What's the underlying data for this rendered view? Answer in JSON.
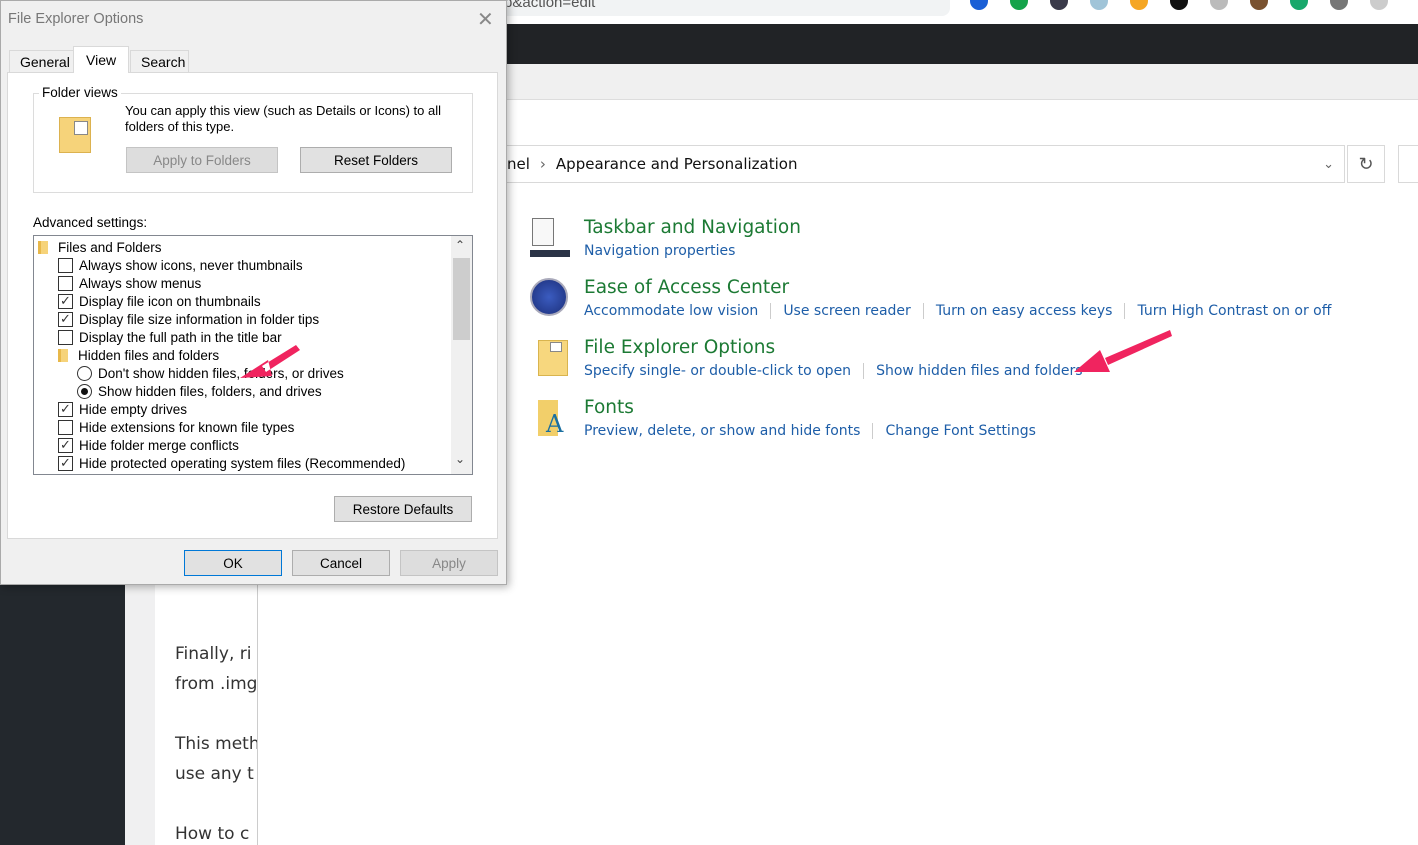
{
  "browser": {
    "address_fragment": "p&action=edit",
    "extension_colors": [
      "#1a5fd6",
      "#15a34a",
      "#3a3a4a",
      "#a0c4d8",
      "#f5a623",
      "#111111",
      "#bbbbbb",
      "#7a5230",
      "#18a86b",
      "#777777",
      "#cccccc"
    ]
  },
  "control_panel": {
    "breadcrumb": [
      "nel",
      "Appearance and Personalization"
    ],
    "categories": [
      {
        "title": "Taskbar and Navigation",
        "icon": "taskbar-icon",
        "links": [
          "Navigation properties"
        ]
      },
      {
        "title": "Ease of Access Center",
        "icon": "ease-of-access-icon",
        "links": [
          "Accommodate low vision",
          "Use screen reader",
          "Turn on easy access keys",
          "Turn High Contrast on or off"
        ]
      },
      {
        "title": "File Explorer Options",
        "icon": "folder-options-icon",
        "links": [
          "Specify single- or double-click to open",
          "Show hidden files and folders"
        ]
      },
      {
        "title": "Fonts",
        "icon": "fonts-icon",
        "links": [
          "Preview, delete, or show and hide fonts",
          "Change Font Settings"
        ]
      }
    ],
    "heading_color": "#1c7a34",
    "link_color": "#1e5ea8"
  },
  "article": {
    "lines": [
      "Finally, ri",
      "from .img",
      "This meth",
      "use any t",
      "How to c"
    ]
  },
  "dialog": {
    "title": "File Explorer Options",
    "tabs": [
      "General",
      "View",
      "Search"
    ],
    "active_tab": "View",
    "folder_views": {
      "label": "Folder views",
      "text": "You can apply this view (such as Details or Icons) to all folders of this type.",
      "apply_button": "Apply to Folders",
      "reset_button": "Reset Folders"
    },
    "advanced_label": "Advanced settings:",
    "settings": [
      {
        "type": "folder",
        "label": "Files and Folders"
      },
      {
        "type": "checkbox",
        "label": "Always show icons, never thumbnails",
        "checked": false
      },
      {
        "type": "checkbox",
        "label": "Always show menus",
        "checked": false
      },
      {
        "type": "checkbox",
        "label": "Display file icon on thumbnails",
        "checked": true
      },
      {
        "type": "checkbox",
        "label": "Display file size information in folder tips",
        "checked": true
      },
      {
        "type": "checkbox",
        "label": "Display the full path in the title bar",
        "checked": false
      },
      {
        "type": "folder",
        "label": "Hidden files and folders"
      },
      {
        "type": "radio",
        "label": "Don't show hidden files, folders, or drives",
        "checked": false
      },
      {
        "type": "radio",
        "label": "Show hidden files, folders, and drives",
        "checked": true
      },
      {
        "type": "checkbox",
        "label": "Hide empty drives",
        "checked": true
      },
      {
        "type": "checkbox",
        "label": "Hide extensions for known file types",
        "checked": false
      },
      {
        "type": "checkbox",
        "label": "Hide folder merge conflicts",
        "checked": true
      },
      {
        "type": "checkbox",
        "label": "Hide protected operating system files (Recommended)",
        "checked": true
      }
    ],
    "restore_button": "Restore Defaults",
    "ok_button": "OK",
    "cancel_button": "Cancel",
    "apply_button": "Apply"
  },
  "annotation_color": "#f0245f"
}
